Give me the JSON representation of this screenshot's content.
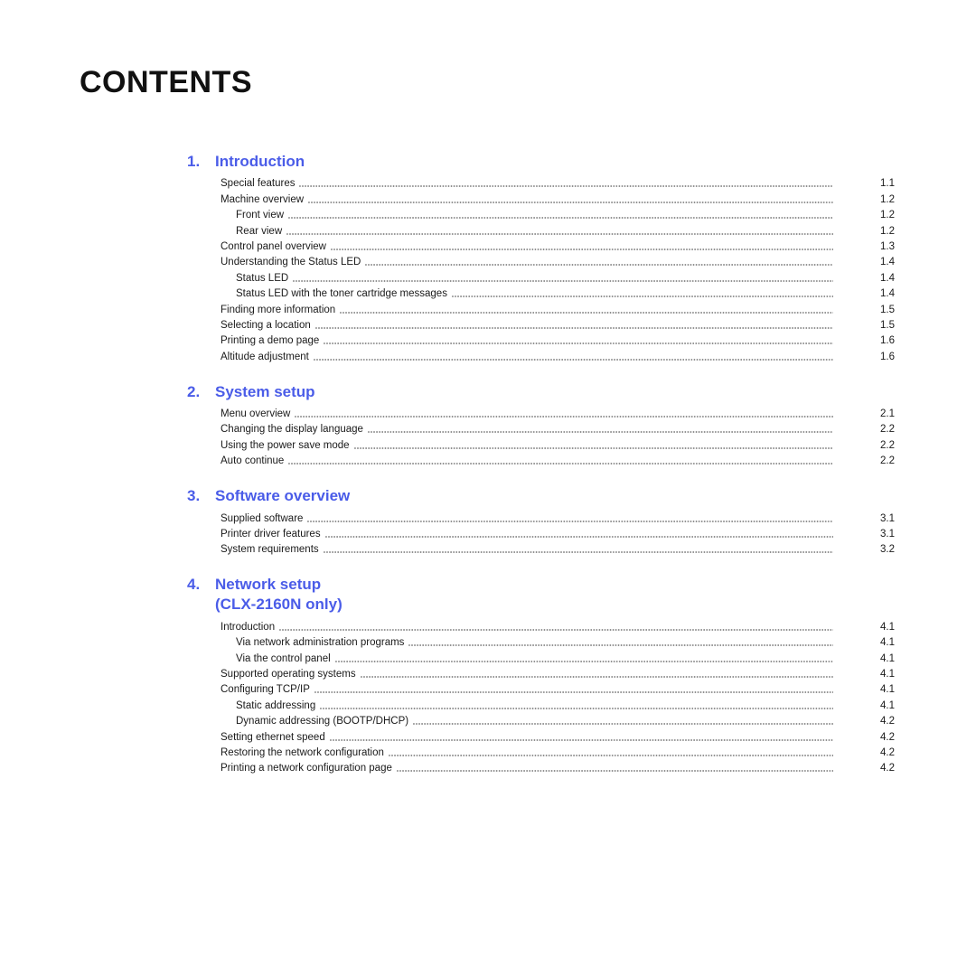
{
  "document": {
    "title": "CONTENTS"
  },
  "sections": [
    {
      "number": "1.",
      "title": "Introduction",
      "title_line2": "",
      "entries": [
        {
          "label": "Special features",
          "page": "1.1",
          "level": 1
        },
        {
          "label": "Machine overview",
          "page": "1.2",
          "level": 1
        },
        {
          "label": "Front view",
          "page": "1.2",
          "level": 2
        },
        {
          "label": "Rear view",
          "page": "1.2",
          "level": 2
        },
        {
          "label": "Control panel overview",
          "page": "1.3",
          "level": 1
        },
        {
          "label": "Understanding the Status LED",
          "page": "1.4",
          "level": 1
        },
        {
          "label": "Status LED",
          "page": "1.4",
          "level": 2
        },
        {
          "label": "Status LED with the toner cartridge messages",
          "page": "1.4",
          "level": 2
        },
        {
          "label": "Finding more information",
          "page": "1.5",
          "level": 1
        },
        {
          "label": "Selecting a location",
          "page": "1.5",
          "level": 1
        },
        {
          "label": "Printing a demo page",
          "page": "1.6",
          "level": 1
        },
        {
          "label": "Altitude adjustment",
          "page": "1.6",
          "level": 1
        }
      ]
    },
    {
      "number": "2.",
      "title": "System setup",
      "title_line2": "",
      "entries": [
        {
          "label": "Menu overview",
          "page": "2.1",
          "level": 1
        },
        {
          "label": "Changing the display language",
          "page": "2.2",
          "level": 1
        },
        {
          "label": "Using the power save mode",
          "page": "2.2",
          "level": 1
        },
        {
          "label": "Auto continue",
          "page": "2.2",
          "level": 1
        }
      ]
    },
    {
      "number": "3.",
      "title": "Software overview",
      "title_line2": "",
      "entries": [
        {
          "label": "Supplied software",
          "page": "3.1",
          "level": 1
        },
        {
          "label": "Printer driver features",
          "page": "3.1",
          "level": 1
        },
        {
          "label": "System requirements",
          "page": "3.2",
          "level": 1
        }
      ]
    },
    {
      "number": "4.",
      "title": "Network setup",
      "title_line2": "(CLX-2160N only)",
      "entries": [
        {
          "label": "Introduction",
          "page": "4.1",
          "level": 1
        },
        {
          "label": "Via network administration programs",
          "page": "4.1",
          "level": 2
        },
        {
          "label": "Via the control panel",
          "page": "4.1",
          "level": 2
        },
        {
          "label": "Supported operating systems",
          "page": "4.1",
          "level": 1
        },
        {
          "label": "Configuring TCP/IP",
          "page": "4.1",
          "level": 1
        },
        {
          "label": "Static addressing",
          "page": "4.1",
          "level": 2
        },
        {
          "label": "Dynamic addressing (BOOTP/DHCP)",
          "page": "4.2",
          "level": 2
        },
        {
          "label": "Setting ethernet speed",
          "page": "4.2",
          "level": 1
        },
        {
          "label": "Restoring the network configuration",
          "page": "4.2",
          "level": 1
        },
        {
          "label": "Printing a network configuration page",
          "page": "4.2",
          "level": 1
        }
      ]
    }
  ],
  "theme": {
    "heading_color": "#4a5ce8",
    "text_color": "#1a1a1a",
    "leader_color": "#8d8d8d",
    "background": "#ffffff"
  }
}
